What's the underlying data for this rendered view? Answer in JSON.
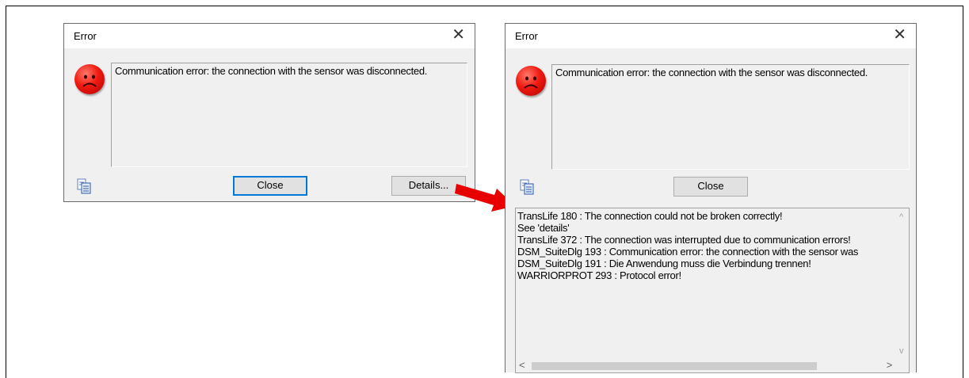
{
  "dialog_left": {
    "title": "Error",
    "message": "Communication error: the connection with the sensor was disconnected.",
    "buttons": {
      "close": "Close",
      "details": "Details..."
    }
  },
  "dialog_right": {
    "title": "Error",
    "message": "Communication error: the connection with the sensor was disconnected.",
    "buttons": {
      "close": "Close"
    },
    "details_lines": [
      "TransLife 180 : The connection could not be broken correctly!",
      "See 'details'",
      "TransLife 372 : The connection was interrupted due to communication errors!",
      "DSM_SuiteDlg 193 : Communication error: the connection with the sensor was",
      "DSM_SuiteDlg 191 : Die Anwendung muss die Verbindung trennen!",
      "WARRIORPROT 293 : Protocol error!"
    ]
  },
  "glyphs": {
    "close": "✕",
    "up": "^",
    "down": "v",
    "left": "<",
    "right": ">"
  },
  "colors": {
    "error_face": "#e8180e",
    "arrow": "#e80000",
    "focus_border": "#0078d7"
  }
}
